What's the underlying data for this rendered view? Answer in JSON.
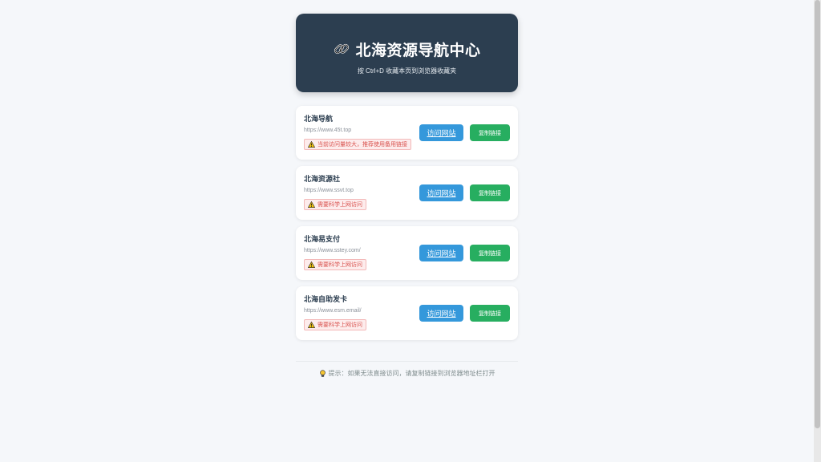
{
  "header": {
    "title": "北海资源导航中心",
    "subtitle": "按 Ctrl+D 收藏本页到浏览器收藏夹",
    "icon": "link-icon"
  },
  "sites": [
    {
      "name": "北海导航",
      "url": "https://www.45t.top",
      "warning": "当前访问量较大，推荐使用备用链接",
      "visit_label": "访问网站",
      "copy_label": "复制链接"
    },
    {
      "name": "北海资源社",
      "url": "https://www.ssvt.top",
      "warning": "需要科学上网访问",
      "visit_label": "访问网站",
      "copy_label": "复制链接"
    },
    {
      "name": "北海易支付",
      "url": "https://www.sstey.com/",
      "warning": "需要科学上网访问",
      "visit_label": "访问网站",
      "copy_label": "复制链接"
    },
    {
      "name": "北海自助发卡",
      "url": "https://www.esm.email/",
      "warning": "需要科学上网访问",
      "visit_label": "访问网站",
      "copy_label": "复制链接"
    }
  ],
  "footer": {
    "text": "提示：如果无法直接访问，请复制链接到浏览器地址栏打开",
    "icon": "lightbulb-icon"
  },
  "colors": {
    "header_bg": "#2c3e50",
    "visit_button": "#3498db",
    "copy_button": "#27ae60",
    "warning_text": "#d9534f",
    "page_bg": "#f5f7fa"
  }
}
